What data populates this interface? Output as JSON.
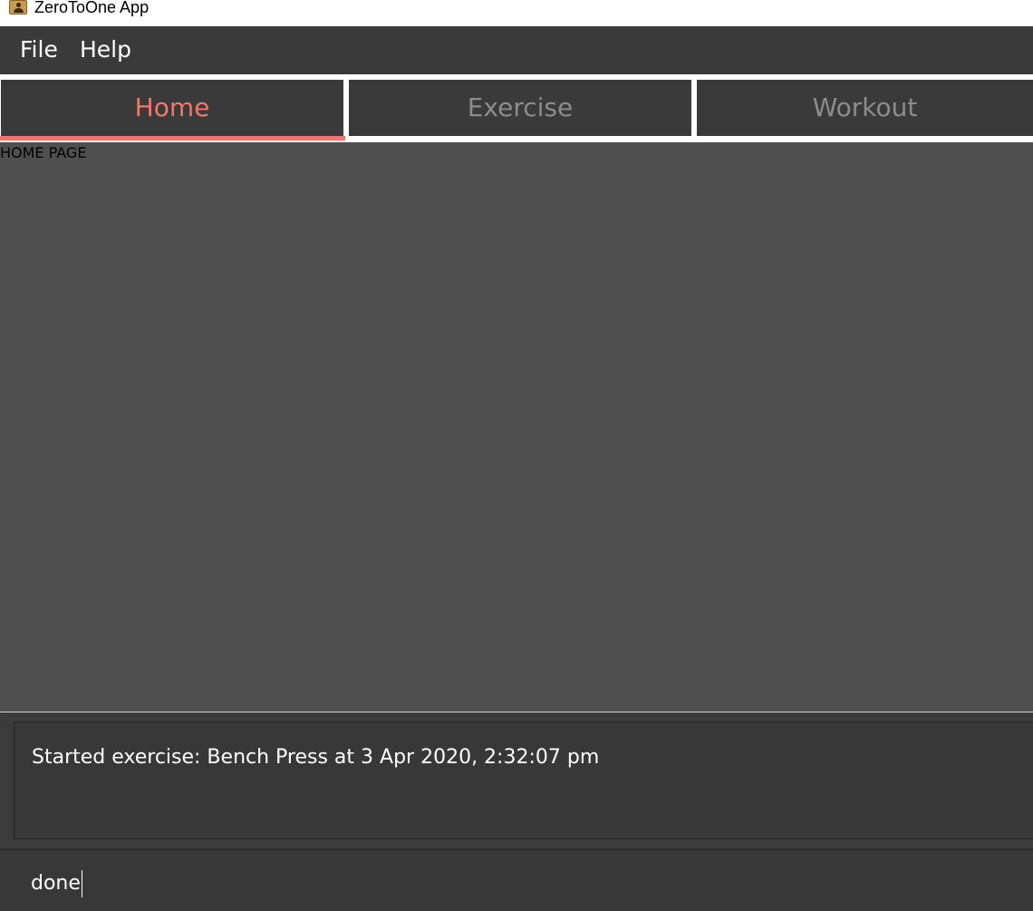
{
  "window": {
    "title": "ZeroToOne App",
    "icon": "app-contact-icon"
  },
  "menubar": {
    "items": [
      {
        "label": "File"
      },
      {
        "label": "Help"
      }
    ]
  },
  "tabs": [
    {
      "label": "Home",
      "selected": true
    },
    {
      "label": "Exercise",
      "selected": false
    },
    {
      "label": "Workout",
      "selected": false
    }
  ],
  "main": {
    "page_label": "HOME PAGE"
  },
  "result_display": {
    "text": "Started exercise: Bench Press at 3 Apr 2020, 2:32:07 pm"
  },
  "command_box": {
    "value": "done"
  },
  "colors": {
    "accent": "#f0786b",
    "menubar_bg": "#3a3a3a",
    "content_bg": "#4f4f4f",
    "inactive_tab_text": "#8c8c8c"
  }
}
